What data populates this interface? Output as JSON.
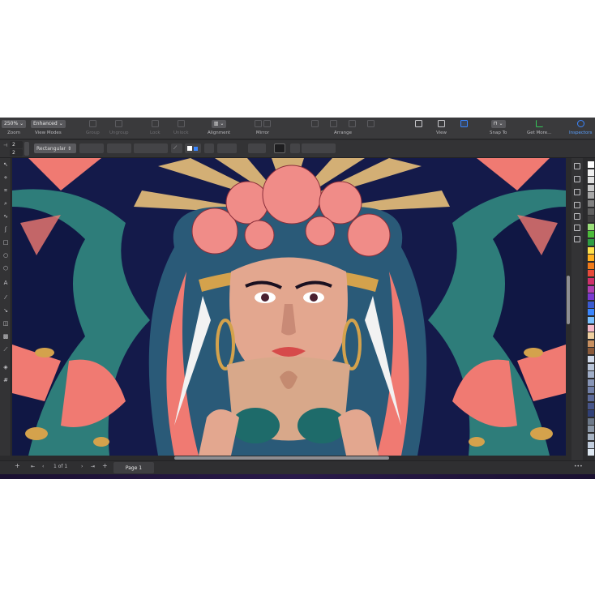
{
  "toolbar": {
    "zoom_value": "250%",
    "zoom_label": "Zoom",
    "view_mode_value": "Enhanced",
    "view_modes_label": "View Modes",
    "group_label": "Group",
    "ungroup_label": "Ungroup",
    "lock_label": "Lock",
    "unlock_label": "Unlock",
    "alignment_label": "Alignment",
    "mirror_label": "Mirror",
    "arrange_label": "Arrange",
    "view_label": "View",
    "snap_to_label": "Snap To",
    "get_more_label": "Get More...",
    "inspectors_label": "Inspectors"
  },
  "propbar": {
    "value_top": "2",
    "value_bottom": "2",
    "shape_type": "Rectangular"
  },
  "pagebar": {
    "add_page": "+",
    "page_of": "1  of  1",
    "add_page_right": "+",
    "page_tab": "Page 1",
    "more": "•••"
  },
  "colors": {
    "accent": "#3a86ff",
    "artwork_bg": "#141a4a",
    "teal": "#2e8b8b",
    "coral": "#f07a72",
    "gold": "#d4a24c"
  },
  "palette": [
    "#ffffff",
    "#f0f0f0",
    "#e0e0e0",
    "#c8c8c8",
    "#a8a8a8",
    "#808080",
    "#606060",
    "#404040",
    "#9be07a",
    "#4cbb3a",
    "#2f9e44",
    "#ffe14a",
    "#ffb020",
    "#f07a1a",
    "#e84a3a",
    "#d0306a",
    "#b040b0",
    "#7a3ad0",
    "#3a5ad0",
    "#3a86ff",
    "#7ac0ff",
    "#f5b8c8",
    "#f0d0a0",
    "#c89060",
    "#8a5a3a",
    "#cfd8e8",
    "#b8c4d8",
    "#a0aec8",
    "#8896b8",
    "#7280a8",
    "#5c6a98",
    "#465488",
    "#304078",
    "#6e7a8a",
    "#8a96a6",
    "#a6b2c2",
    "#c2cede",
    "#dee8f2"
  ]
}
